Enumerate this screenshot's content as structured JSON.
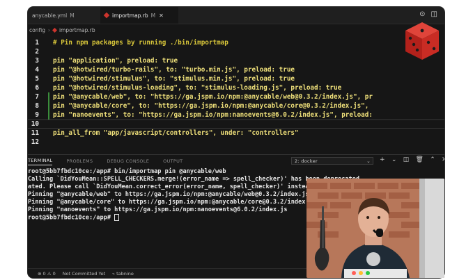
{
  "tabs": [
    {
      "label": "anycable.yml",
      "badge": "M",
      "active": false
    },
    {
      "label": "importmap.rb",
      "badge": "M",
      "active": true
    }
  ],
  "breadcrumb": [
    "config",
    "importmap.rb"
  ],
  "code_lines": [
    {
      "num": "1",
      "text": "# Pin npm packages by running ./bin/importmap"
    },
    {
      "num": "2",
      "text": ""
    },
    {
      "num": "3",
      "text": "pin \"application\", preload: true"
    },
    {
      "num": "4",
      "text": "pin \"@hotwired/turbo-rails\", to: \"turbo.min.js\", preload: true"
    },
    {
      "num": "5",
      "text": "pin \"@hotwired/stimulus\", to: \"stimulus.min.js\", preload: true"
    },
    {
      "num": "6",
      "text": "pin \"@hotwired/stimulus-loading\", to: \"stimulus-loading.js\", preload: true"
    },
    {
      "num": "7",
      "text": "pin \"@anycable/web\", to: \"https://ga.jspm.io/npm:@anycable/web@0.3.2/index.js\", pr"
    },
    {
      "num": "8",
      "text": "pin \"@anycable/core\", to: \"https://ga.jspm.io/npm:@anycable/core@0.3.2/index.js\","
    },
    {
      "num": "9",
      "text": "pin \"nanoevents\", to: \"https://ga.jspm.io/npm:nanoevents@6.0.2/index.js\", preload:"
    },
    {
      "num": "10",
      "text": ""
    },
    {
      "num": "11",
      "text": "pin_all_from \"app/javascript/controllers\", under: \"controllers\""
    },
    {
      "num": "12",
      "text": ""
    }
  ],
  "panel": {
    "tabs": [
      "TERMINAL",
      "PROBLEMS",
      "DEBUG CONSOLE",
      "OUTPUT"
    ],
    "terminal_select": "2: docker"
  },
  "terminal_lines": [
    "root@5bb7fbdc10ce:/app# bin/importmap pin @anycable/web",
    "Calling `DidYouMean::SPELL_CHECKERS.merge!(error_name => spell_checker)' has been deprecated.",
    "ated. Please call `DidYouMean.correct_error(error_name, spell_checker)' instead.",
    "Pinning \"@anycable/web\" to https://ga.jspm.io/npm:@anycable/web@0.3.2/index.js",
    "Pinning \"@anycable/core\" to https://ga.jspm.io/npm:@anycable/core@0.3.2/index.js",
    "Pinning \"nanoevents\" to https://ga.jspm.io/npm:nanoevents@6.0.2/index.js",
    "root@5bb7fbdc10ce:/app# "
  ],
  "status": {
    "problems": "⊗ 0 ⚠ 0",
    "git": "Not Committed Yet",
    "indent": "⌁ tabnine"
  },
  "colors": {
    "editor_bg": "#161616",
    "accent_ruby": "#cc342d",
    "comment": "#d7c53a",
    "string": "#efe07a"
  }
}
